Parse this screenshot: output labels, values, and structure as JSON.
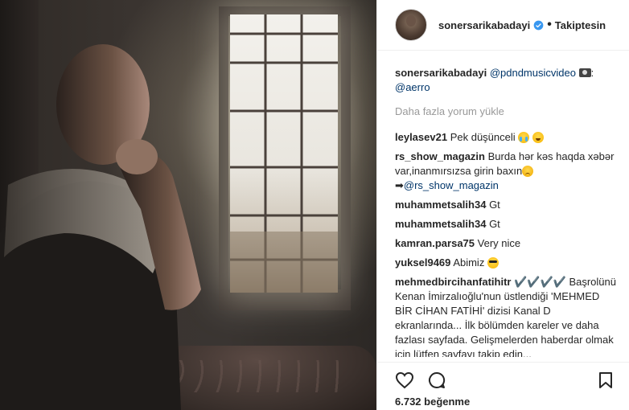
{
  "header": {
    "username": "sonersarikabadayi",
    "follow_label": "Takiptesin",
    "separator": "•"
  },
  "caption": {
    "username": "sonersarikabadayi",
    "mention1": "@pdndmusicvideo",
    "mention2": "@aerro"
  },
  "load_more": "Daha fazla yorum yükle",
  "comments": [
    {
      "user": "leylasev21",
      "text": "Pek düşünceli"
    },
    {
      "user": "rs_show_magazin",
      "text": "Burda hər kəs haqda xəbər var,inanmırsızsa girin baxın",
      "arrow": "➡",
      "link": "@rs_show_magazin"
    },
    {
      "user": "muhammetsalih34",
      "text": "Gt"
    },
    {
      "user": "muhammetsalih34",
      "text": "Gt"
    },
    {
      "user": "kamran.parsa75",
      "text": "Very nice"
    },
    {
      "user": "yuksel9469",
      "text": "Abimiz"
    },
    {
      "user": "mehmedbircihanfatihitr",
      "text": "✔️✔️✔️✔️ Başrolünü Kenan İmirzalıoğlu'nun üstlendiği 'MEHMED BİR CİHAN FATİHİ' dizisi Kanal D ekranlarında... İlk bölümden kareler ve daha fazlası sayfada. Gelişmelerden haberdar olmak için lütfen sayfayı takip edin...",
      "tail": "✔️✔️✔️✔️"
    }
  ],
  "icons": {
    "like": "heart-icon",
    "comment": "comment-icon",
    "save": "bookmark-icon",
    "verified": "verified-badge-icon"
  },
  "likes_label": "6.732 beğenme",
  "colors": {
    "link": "#003569",
    "muted": "#999999",
    "verified": "#3897f0"
  }
}
